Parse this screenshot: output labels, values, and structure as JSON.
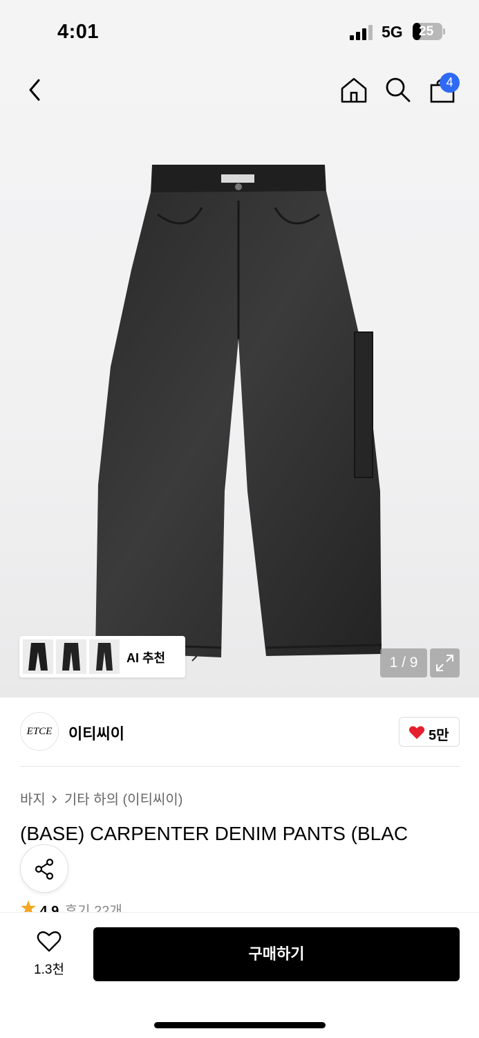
{
  "status_bar": {
    "time": "4:01",
    "network": "5G",
    "battery": "25"
  },
  "nav": {
    "cart_count": "4",
    "icons": [
      "back-arrow-icon",
      "home-icon",
      "search-icon",
      "shopping-bag-icon"
    ]
  },
  "gallery": {
    "page_indicator": "1 / 9",
    "ai_recommend_label": "AI 추천"
  },
  "brand": {
    "logo_text": "ETCE",
    "name": "이티씨이",
    "likes": "5만"
  },
  "breadcrumb": {
    "category": "바지",
    "subcategory": "기타 하의 (이티씨이)"
  },
  "product": {
    "title": "(BASE) CARPENTER DENIM PANTS (BLAC",
    "rating": "4.9",
    "review_text": "후기 22개"
  },
  "bottom": {
    "wishlist_count": "1.3천",
    "buy_label": "구매하기"
  },
  "colors": {
    "accent_badge": "#2f6af5",
    "heart": "#e5202e",
    "star": "#f5a623",
    "buy_button": "#000000"
  }
}
